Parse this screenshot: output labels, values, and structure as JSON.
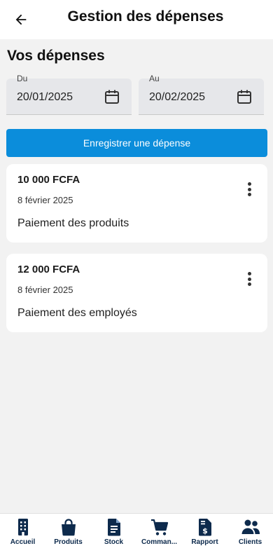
{
  "header": {
    "title": "Gestion des dépenses",
    "back_icon": "arrow-left-icon"
  },
  "section": {
    "title": "Vos dépenses"
  },
  "filters": {
    "from": {
      "label": "Du",
      "value": "20/01/2025",
      "icon": "calendar-icon"
    },
    "to": {
      "label": "Au",
      "value": "20/02/2025",
      "icon": "calendar-icon"
    }
  },
  "actions": {
    "add_expense_label": "Enregistrer une dépense",
    "accent_color": "#0b8ddb"
  },
  "expenses": [
    {
      "amount": "10 000 FCFA",
      "date": "8 février 2025",
      "description": "Paiement des produits"
    },
    {
      "amount": "12 000 FCFA",
      "date": "8 février 2025",
      "description": "Paiement des employés"
    }
  ],
  "bottom_nav": {
    "icon_color": "#0d2a4c",
    "items": [
      {
        "label": "Accueil",
        "icon": "building-icon"
      },
      {
        "label": "Produits",
        "icon": "shopping-bag-icon"
      },
      {
        "label": "Stock",
        "icon": "document-icon"
      },
      {
        "label": "Comman...",
        "icon": "cart-icon"
      },
      {
        "label": "Rapport",
        "icon": "invoice-dollar-icon"
      },
      {
        "label": "Clients",
        "icon": "users-icon"
      }
    ]
  }
}
